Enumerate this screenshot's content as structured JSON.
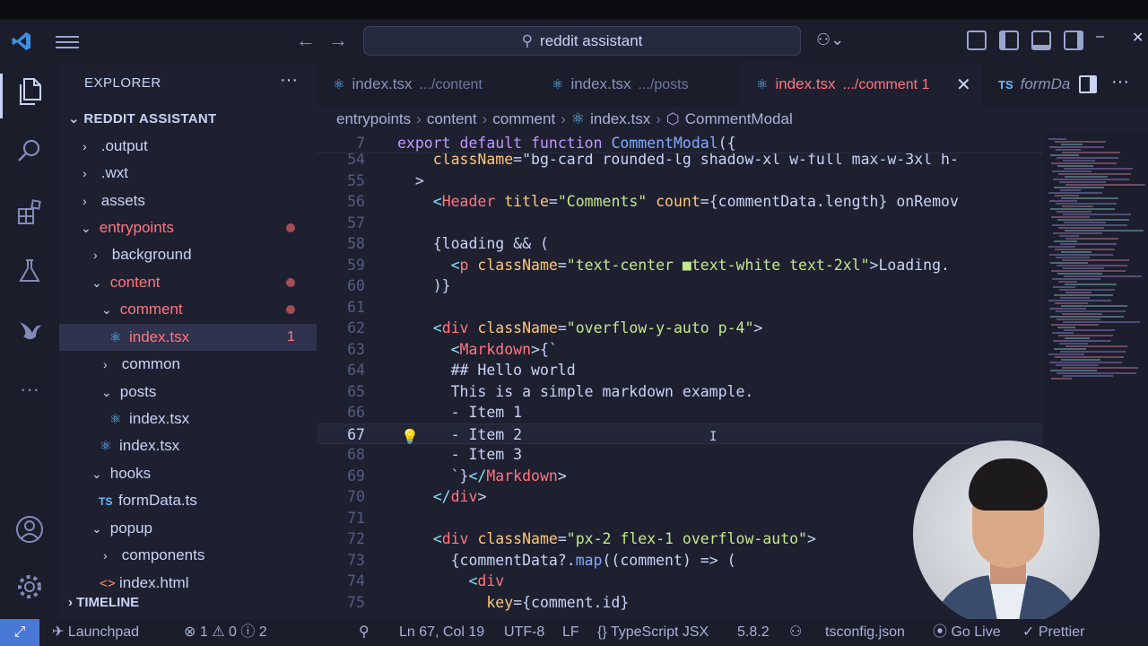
{
  "titlebar": {
    "search_text": "reddit assistant",
    "back": "←",
    "forward": "→",
    "copilot": "⚇⌄",
    "minimize": "–",
    "close": "✕"
  },
  "explorer": {
    "title": "EXPLORER",
    "more": "···",
    "root": "REDDIT ASSISTANT",
    "timeline": "TIMELINE",
    "items": [
      {
        "label": ".output"
      },
      {
        "label": ".wxt"
      },
      {
        "label": "assets"
      },
      {
        "label": "entrypoints"
      },
      {
        "label": "background"
      },
      {
        "label": "content"
      },
      {
        "label": "comment"
      },
      {
        "label": "index.tsx",
        "badge": "1"
      },
      {
        "label": "common"
      },
      {
        "label": "posts"
      },
      {
        "label": "index.tsx"
      },
      {
        "label": "index.tsx"
      },
      {
        "label": "hooks"
      },
      {
        "label": "formData.ts",
        "type_badge": "TS"
      },
      {
        "label": "popup"
      },
      {
        "label": "components"
      },
      {
        "label": "index.html"
      }
    ]
  },
  "tabs": [
    {
      "name": "index.tsx",
      "dir": ".../content"
    },
    {
      "name": "index.tsx",
      "dir": ".../posts"
    },
    {
      "name": "index.tsx",
      "dir": ".../comment 1"
    },
    {
      "name": "formData.ts",
      "prefix": "TS",
      "visible": "formDa"
    }
  ],
  "breadcrumb": [
    "entrypoints",
    "content",
    "comment",
    "index.tsx",
    "CommentModal"
  ],
  "editor": {
    "lines": [
      {
        "n": "7",
        "text": "export default function CommentModal({"
      },
      {
        "n": "54",
        "text": "    className=\"bg-card rounded-lg shadow-xl w-full max-w-3xl h-"
      },
      {
        "n": "55",
        "text": "  >"
      },
      {
        "n": "56",
        "text": "    <Header title=\"Comments\" count={commentData.length} onRemov"
      },
      {
        "n": "57",
        "text": ""
      },
      {
        "n": "58",
        "text": "    {loading && ("
      },
      {
        "n": "59",
        "text": "      <p className=\"text-center ■text-white text-2xl\">Loading."
      },
      {
        "n": "60",
        "text": "    )}"
      },
      {
        "n": "61",
        "text": ""
      },
      {
        "n": "62",
        "text": "    <div className=\"overflow-y-auto p-4\">"
      },
      {
        "n": "63",
        "text": "      <Markdown>{`"
      },
      {
        "n": "64",
        "text": "      ## Hello world"
      },
      {
        "n": "65",
        "text": "      This is a simple markdown example."
      },
      {
        "n": "66",
        "text": "      - Item 1"
      },
      {
        "n": "67",
        "text": "      - Item 2"
      },
      {
        "n": "68",
        "text": "      - Item 3"
      },
      {
        "n": "69",
        "text": "      `}</Markdown>"
      },
      {
        "n": "70",
        "text": "    </div>"
      },
      {
        "n": "71",
        "text": ""
      },
      {
        "n": "72",
        "text": "    <div className=\"px-2 flex-1 overflow-auto\">"
      },
      {
        "n": "73",
        "text": "      {commentData?.map((comment) => ("
      },
      {
        "n": "74",
        "text": "        <div"
      },
      {
        "n": "75",
        "text": "          key={comment.id}"
      }
    ]
  },
  "statusbar": {
    "launchpad": "Launchpad",
    "problems": "⊗ 1 ⚠ 0 ⓘ 2",
    "position": "Ln 67, Col 19",
    "encoding": "UTF-8",
    "eol": "LF",
    "language": "TypeScript JSX",
    "version": "5.8.2",
    "tsconfig": "tsconfig.json",
    "golive": "Go Live",
    "prettier": "Prettier"
  },
  "colors": {
    "accent_red": "#ff757f",
    "keyword": "#c099ff",
    "string": "#c3e88d",
    "tag": "#ff757f",
    "attr": "#ffc777",
    "func": "#82aaff"
  }
}
